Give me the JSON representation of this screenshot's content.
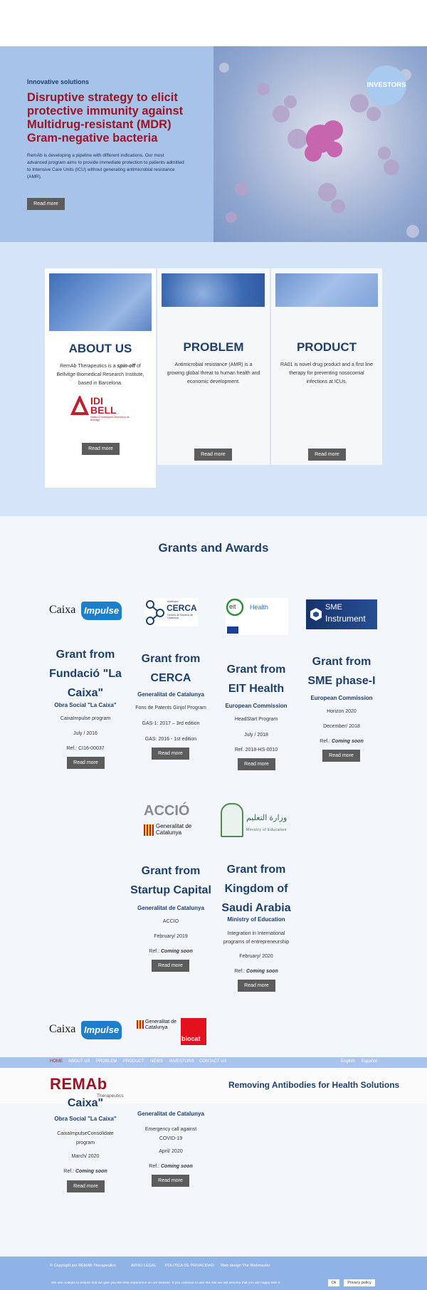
{
  "hero": {
    "eyebrow": "Innovative solutions",
    "headline": "Disruptive strategy to elicit protective immunity against Multidrug-resistant (MDR) Gram-negative bacteria",
    "description": "RemAb is developing a pipeline with different indications. Our most advanced program aims to provide immediate protection to patients admitted to Intensive Care Units (ICU) without generating antimicrobial resistance (AMR).",
    "read_more": "Read more",
    "investors_badge": "INVESTORS"
  },
  "cards": [
    {
      "title": "ABOUT US",
      "text_pre": "RemAb Therapeutics is a ",
      "text_em": "spin-off",
      "text_post": " of Bellvitge Biomedical Research Institute, based in Barcelona.",
      "logo_text": "IDI BELL",
      "logo_sub": "Institut d'Investigació Biomèdica de Bellvitge",
      "button": "Read more"
    },
    {
      "title": "PROBLEM",
      "text": "Antimicrobial resistance (AMR) is a growing global threat to human health and economic development.",
      "button": "Read more"
    },
    {
      "title": "PRODUCT",
      "text": "RA01 is novel drug product and a first line therapy for preventing nosocomial infections at ICUs.",
      "button": "Read more"
    }
  ],
  "grants_heading": "Grants and Awards",
  "grants": [
    {
      "logo_a": "Caixa",
      "logo_b": "Impulse",
      "title": "Grant from Fundació \"La Caixa\"",
      "subtitle": "Obra Social \"La Caixa\"",
      "line1": "CaixaImpulse program",
      "line2": "July / 2016",
      "ref_label": "Ref.: ",
      "ref_value": "CI16-00037",
      "button": "Read more"
    },
    {
      "logo_a": "Institució",
      "logo_b": "CERCA",
      "logo_c": "Centres de Recerca de Catalunya",
      "title": "Grant from CERCA",
      "subtitle": "Generalitat de Catalunya",
      "line1": "Fons de Patents Ginjol Program",
      "line2": "GAS-1: 2017 – 3rd edition",
      "line3": "GAS: 2016 - 1st edition",
      "button": "Read more"
    },
    {
      "logo_a": "eit",
      "logo_b": "Health",
      "title": "Grant from EIT Health",
      "subtitle": "European Commission",
      "line1": "HeadStart Program",
      "line2": "July / 2018",
      "ref_label": "Ref. ",
      "ref_value": "2018-HS-0010",
      "button": "Read more"
    },
    {
      "logo_a": "SME",
      "logo_b": "Instrument",
      "title": "Grant from SME phase-I",
      "subtitle": "European Commission",
      "line1": "Horizon 2020",
      "line2": "December/ 2018",
      "ref_label": "Ref.: ",
      "ref_value": "Coming soon",
      "button": "Read more"
    },
    {
      "logo_a": "ACCIÓ",
      "logo_b": "Generalitat de Catalunya",
      "title": "Grant from Startup Capital",
      "subtitle": "Generalitat de Catalunya",
      "line1": "ACCIO",
      "line2": "February/ 2019",
      "ref_label": "Ref.: ",
      "ref_value": "Coming soon",
      "button": "Read more"
    },
    {
      "logo_a": "وزارة التعليم",
      "logo_b": "Ministry of Education",
      "title": "Grant from Kingdom of Saudi Arabia",
      "subtitle": "Ministry of Education",
      "line1": "Integration in International programs of entrepreneurship",
      "line2": "February/ 2020",
      "ref_label": "Ref.: ",
      "ref_value": "Coming soon",
      "button": "Read more"
    },
    {
      "logo_a": "Caixa",
      "logo_b": "Impulse",
      "title_tail": "Caixa\"",
      "subtitle": "Obra Social \"La Caixa\"",
      "line1": "CaixaImpulseConsolidate program",
      "line2": "March/ 2020",
      "ref_label": "Ref.: ",
      "ref_value": "Coming soon",
      "button": "Read more"
    },
    {
      "logo_a": "Generalitat de Catalunya",
      "logo_b": "biocat",
      "subtitle": "Generalitat de Catalunya",
      "line1": "Emergency call against COVID-19",
      "line2": "April/ 2020",
      "ref_label": "Ref.: ",
      "ref_value": "Coming soon",
      "button": "Read more"
    }
  ],
  "nav": {
    "items": [
      "HOME",
      "ABOUT US",
      "PROBLEM",
      "PRODUCT",
      "NEWS",
      "INVESTORS",
      "CONTACT US"
    ],
    "lang": [
      "English",
      "Español"
    ]
  },
  "brand": {
    "logo": "REMAb",
    "logo_sub": "Therapeutics",
    "tagline": "Removing Antibodies for Health Solutions"
  },
  "footer": {
    "copyright": "© Copyright por REMAB Therapeutics",
    "links": [
      "AVISO LEGAL",
      "POLITICA DE PRIVACIDAD",
      "Web design The Webmaster"
    ],
    "cookie_text": "We use cookies to ensure that we give you the best experience on our website. If you continue to use this site we will assume that you are happy with it.",
    "ok": "Ok",
    "privacy": "Privacy policy"
  },
  "colors": {
    "accent": "#1d3f6e",
    "headline": "#9b1526",
    "hero_bg": "#a7c3ea",
    "nav_bg": "#a8c4ec"
  }
}
